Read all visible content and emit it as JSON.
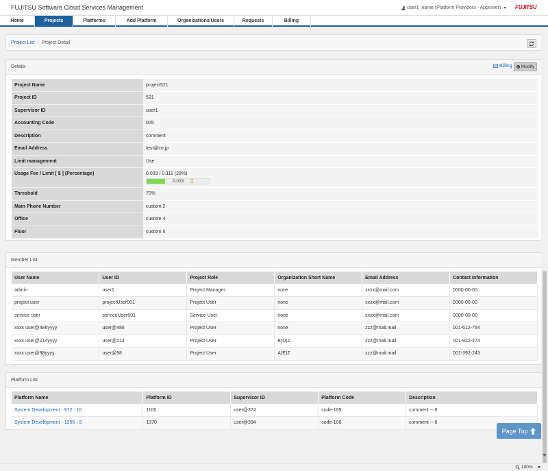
{
  "header": {
    "app_title": "FUJITSU Software Cloud Services Management",
    "user_menu": "user1_name (Platform Providers - Approver)",
    "logo": "FUJITSU"
  },
  "nav": {
    "tabs": [
      {
        "label": "Home",
        "active": false
      },
      {
        "label": "Projects",
        "active": true
      },
      {
        "label": "Platforms",
        "active": false
      },
      {
        "label": "Add Platform",
        "active": false
      },
      {
        "label": "Organizations/Users",
        "active": false
      },
      {
        "label": "Requests",
        "active": false
      },
      {
        "label": "Billing",
        "active": false
      }
    ]
  },
  "breadcrumb": {
    "link": "Project List",
    "separator": "/",
    "current": "Project Detail"
  },
  "details": {
    "title": "Details",
    "billing_label": "Billing",
    "modify_label": "Modify",
    "rows": [
      {
        "label": "Project Name",
        "value": "project521"
      },
      {
        "label": "Project ID",
        "value": "521"
      },
      {
        "label": "Supervisor ID",
        "value": "user1"
      },
      {
        "label": "Accounting Code",
        "value": "005"
      },
      {
        "label": "Description",
        "value": "comment"
      },
      {
        "label": "Email Address",
        "value": "test@co.jp"
      },
      {
        "label": "Limit management",
        "value": "Use"
      }
    ],
    "usage": {
      "label": "Usage Fee / Limit [ $ ] (Percentage)",
      "summary": "0.033 / 0.111 (29%)",
      "bar_value": "0.033",
      "fill_fraction": 0.29,
      "threshold_fraction": 0.7
    },
    "rows_after": [
      {
        "label": "Threshold",
        "value": "70%"
      },
      {
        "label": "Main Phone Number",
        "value": "custom 2"
      },
      {
        "label": "Office",
        "value": "custom 4"
      },
      {
        "label": "Floor",
        "value": "custom 5"
      }
    ]
  },
  "members": {
    "title": "Member List",
    "columns": [
      "User Name",
      "User ID",
      "Project Role",
      "Organization Short Name",
      "Email Address",
      "Contact Information"
    ],
    "rows": [
      [
        "admin",
        "user1",
        "Project Manager",
        "none",
        "xxxx@mail.com",
        "0000-00-00"
      ],
      [
        "project user",
        "projectUser001",
        "Project User",
        "none",
        "xxxx@mail.com",
        "0000-00-00"
      ],
      [
        "service user",
        "serviceUser001",
        "Service User",
        "none",
        "xxxx@mail.com",
        "0000-00-00"
      ],
      [
        "xxxx user@486yyyy",
        "user@486",
        "Project User",
        "none",
        "zzz@mail.mail",
        "001-612-764"
      ],
      [
        "xxxx user@214yyyy",
        "user@214",
        "Project User",
        "B)D)Z",
        "zzz@mail.mail",
        "001-922-474"
      ],
      [
        "xxxx user@98yyyy",
        "user@98",
        "Project User",
        "A)E)Z",
        "zzz@mail.mail",
        "001-392-243"
      ]
    ]
  },
  "platforms": {
    "title": "Platform List",
    "columns": [
      "Platform Name",
      "Platform ID",
      "Supervisor ID",
      "Platform Code",
      "Description"
    ],
    "rows": [
      [
        "System Development - 972 - 10",
        "1100",
        "user@374",
        "code-109",
        "comment -- 9"
      ],
      [
        "System Development - 1256 - 9",
        "1370",
        "user@394",
        "code-108",
        "comment -- 8"
      ]
    ]
  },
  "page_top_label": "Page Top",
  "zoom_label": "100%"
}
